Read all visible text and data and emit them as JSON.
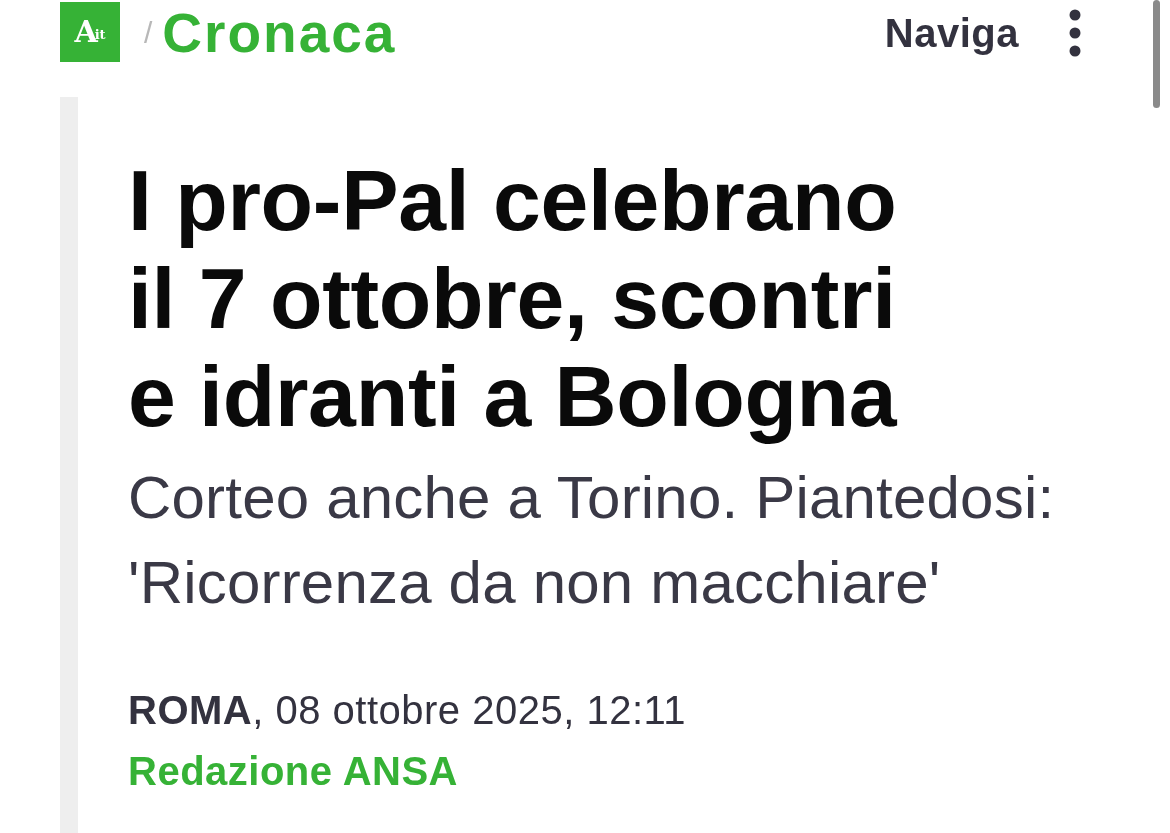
{
  "header": {
    "logo": {
      "letter": "A",
      "suffix": "it"
    },
    "separator": "/",
    "section": "Cronaca",
    "nav_button": "Naviga"
  },
  "article": {
    "headline": "I pro-Pal celebrano il 7 ottobre, scontri e idranti a Bologna",
    "subtitle": "Corteo anche a Torino. Piantedosi: 'Ricorrenza da non macchiare'",
    "dateline": "**ROMA**, 08 ottobre 2025, 12:11",
    "byline": "Redazione ANSA"
  }
}
